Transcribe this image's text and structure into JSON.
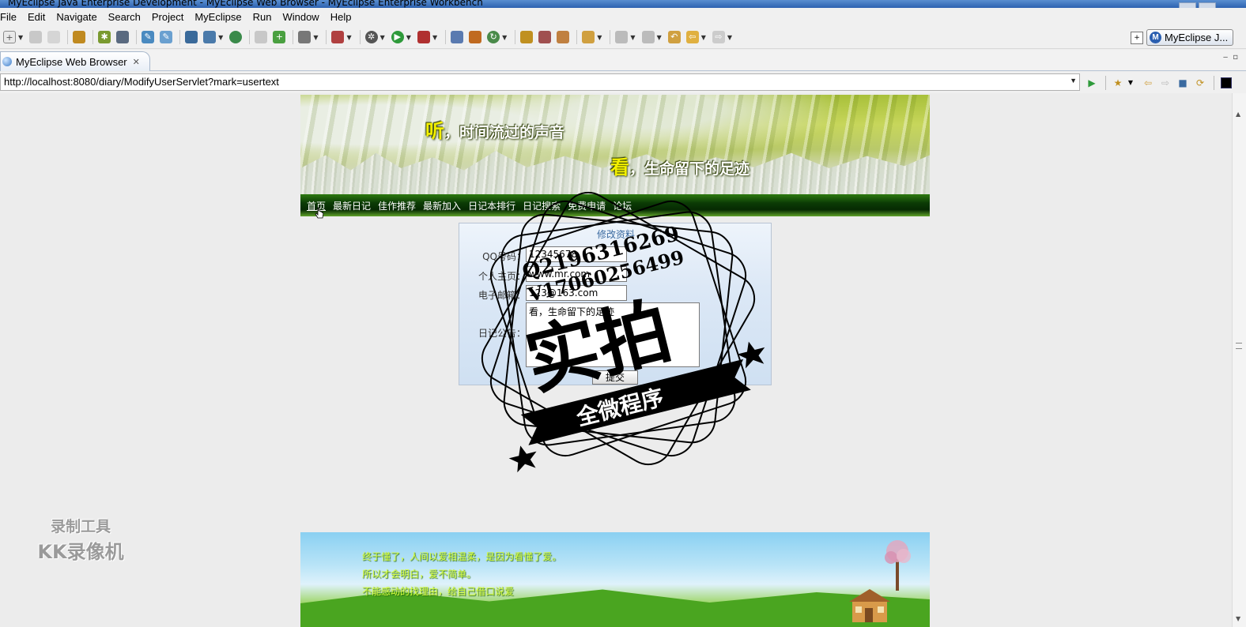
{
  "window": {
    "title": "MyEclipse Java Enterprise Development - MyEclipse Web Browser - MyEclipse Enterprise Workbench"
  },
  "menubar": {
    "items": [
      "File",
      "Edit",
      "Navigate",
      "Search",
      "Project",
      "MyEclipse",
      "Run",
      "Window",
      "Help"
    ]
  },
  "perspective": {
    "label": "MyEclipse J..."
  },
  "editor_tab": {
    "label": "MyEclipse Web Browser"
  },
  "browser": {
    "url": "http://localhost:8080/diary/ModifyUserServlet?mark=usertext"
  },
  "site": {
    "slogan1_big": "听",
    "slogan1_rest": "，时间流过的声音",
    "slogan2_big": "看",
    "slogan2_rest": "，生命留下的足迹",
    "nav": [
      "首页",
      "最新日记",
      "佳作推荐",
      "最新加入",
      "日记本排行",
      "日记搜索",
      "免费申请",
      "论坛"
    ]
  },
  "form": {
    "title": "修改资料",
    "qq_label": "QQ号码：",
    "qq_value": "12345678",
    "homepage_label": "个人主页：",
    "homepage_value": "www.mr.com",
    "email_label": "电子邮箱：",
    "email_value": "123@163.com",
    "notice_label": "日记公告：",
    "notice_value": "看，生命留下的足迹",
    "submit_label": "提交"
  },
  "footer": {
    "lines": [
      "终于懂了，人间以爱相温柔，是因为看懂了爱。",
      "所以才会明白，爱不简单。",
      "不能感动的找理由，给自己借口说爱"
    ]
  },
  "watermark": {
    "line1": "录制工具",
    "line2": "KK录像机"
  },
  "stamp": {
    "qq": "Q2196316269",
    "v": "V17060256499",
    "big": "实拍",
    "ribbon": "全微程序"
  },
  "colors": {
    "nav_dark_green": "#0b3a05",
    "slogan_yellow": "#f4f000",
    "form_bg": "#dce8f6"
  }
}
